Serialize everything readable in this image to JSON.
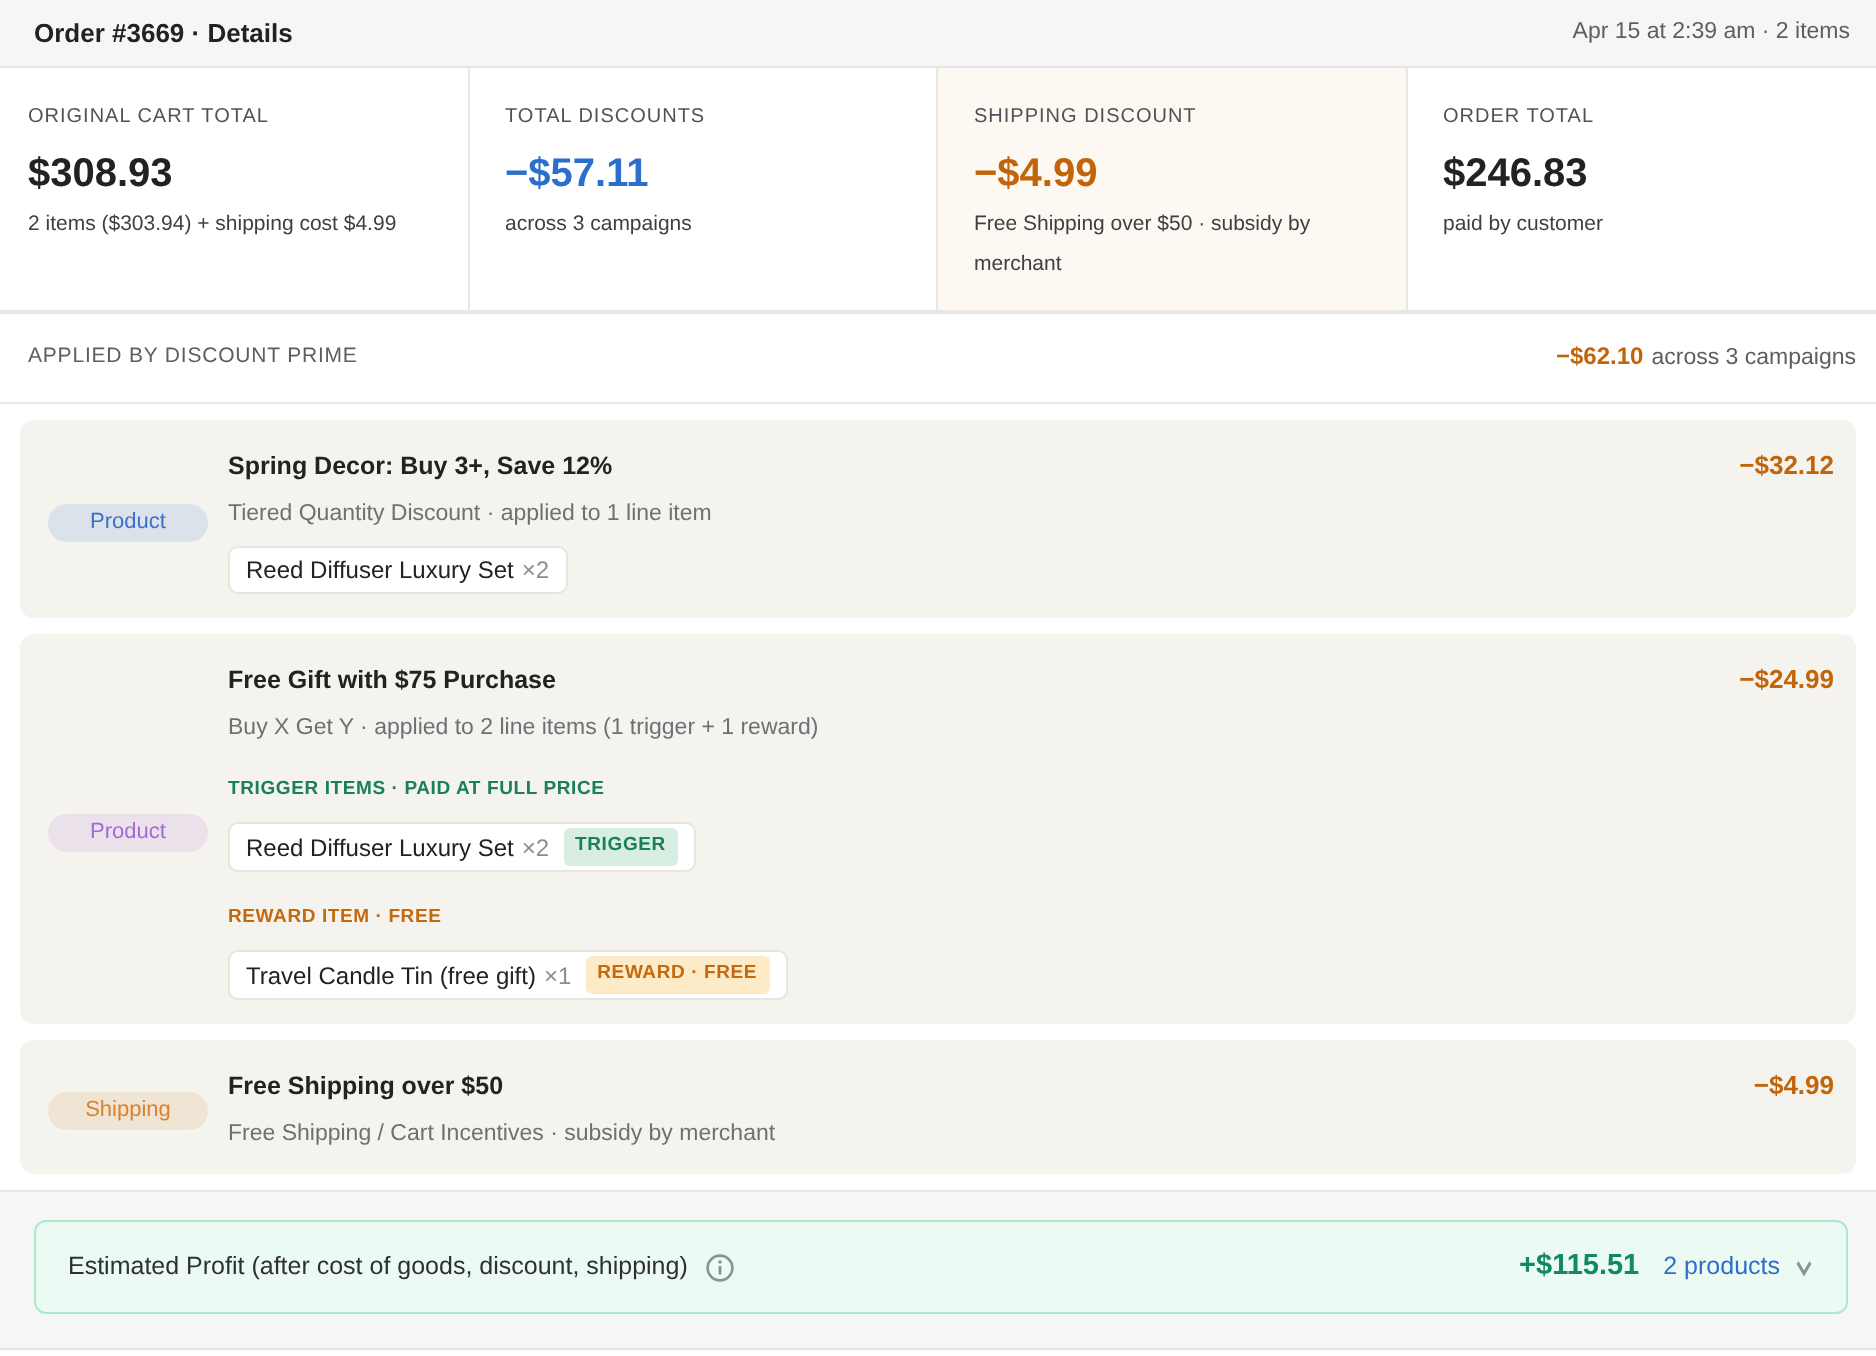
{
  "header": {
    "title": "Order #3669 · Details",
    "meta": "Apr 15 at 2:39 am · 2 items"
  },
  "stats": [
    {
      "kind": "total",
      "label": "ORIGINAL CART TOTAL",
      "value": "$308.93",
      "note": "2 items ($303.94) + shipping cost $4.99"
    },
    {
      "kind": "discount",
      "label": "TOTAL DISCOUNTS",
      "value": "−$57.11",
      "note": "across 3 campaigns"
    },
    {
      "kind": "shipping",
      "label": "SHIPPING DISCOUNT",
      "value": "−$4.99",
      "note": "Free Shipping over $50 · subsidy by merchant"
    },
    {
      "kind": "total",
      "label": "ORDER TOTAL",
      "value": "$246.83",
      "note": "paid by customer"
    }
  ],
  "applied": {
    "label": "APPLIED BY DISCOUNT PRIME",
    "amount": "−$62.10",
    "note": "across 3 campaigns"
  },
  "campaigns": [
    {
      "category": "Product",
      "color": "#3d6fc9",
      "title": "Spring Decor: Buy 3+, Save 12%",
      "subtitle": "Tiered Quantity Discount · applied to 1 line item",
      "amount": "−$32.12",
      "sections": [
        {
          "kind": "plain",
          "items": [
            {
              "name": "Reed Diffuser Luxury Set",
              "qty": "×2"
            }
          ]
        }
      ]
    },
    {
      "category": "Product",
      "color": "#a46ad6",
      "title": "Free Gift with $75 Purchase",
      "subtitle": "Buy X Get Y · applied to 2 line items (1 trigger + 1 reward)",
      "amount": "−$24.99",
      "sections": [
        {
          "kind": "trigger",
          "heading": "TRIGGER ITEMS · PAID AT FULL PRICE",
          "items": [
            {
              "name": "Reed Diffuser Luxury Set",
              "qty": "×2",
              "tag": "TRIGGER"
            }
          ]
        },
        {
          "kind": "reward",
          "heading": "REWARD ITEM · FREE",
          "items": [
            {
              "name": "Travel Candle Tin (free gift)",
              "qty": "×1",
              "tag": "REWARD · FREE"
            }
          ]
        }
      ]
    },
    {
      "category": "Shipping",
      "color": "#d9822b",
      "title": "Free Shipping over $50",
      "subtitle": "Free Shipping / Cart Incentives · subsidy by merchant",
      "amount": "−$4.99"
    }
  ],
  "profit": {
    "label": "Estimated Profit (after cost of goods, discount, shipping)",
    "amount": "+$115.51",
    "link": "2 products",
    "expanded": false
  }
}
